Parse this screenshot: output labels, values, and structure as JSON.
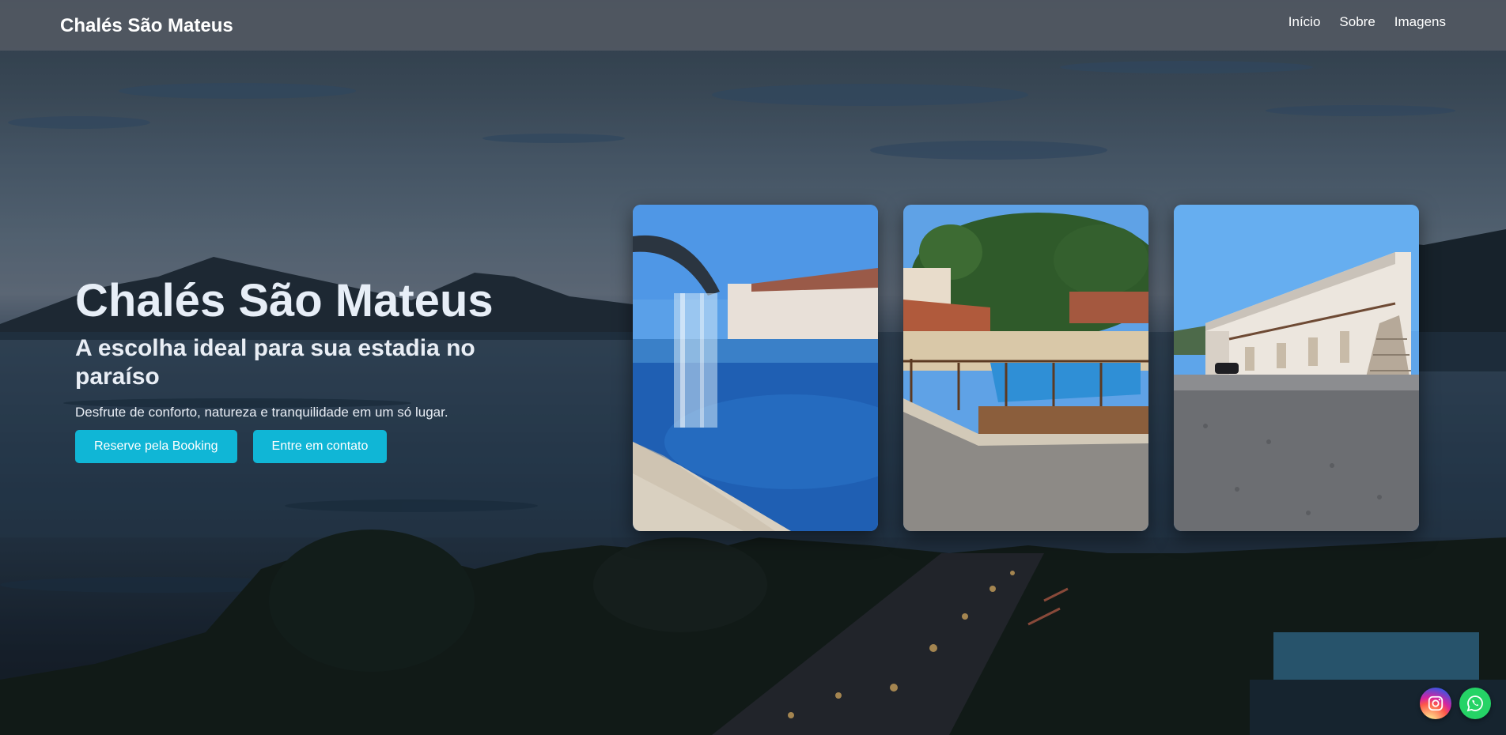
{
  "navbar": {
    "brand": "Chalés São Mateus",
    "links": [
      {
        "label": "Início"
      },
      {
        "label": "Sobre"
      },
      {
        "label": "Imagens"
      }
    ]
  },
  "hero": {
    "title": "Chalés São Mateus",
    "subtitle": "A escolha ideal para sua estadia no paraíso",
    "description": "Desfrute de conforto, natureza e tranquilidade em um só lugar.",
    "buttons": [
      {
        "label": "Reserve pela Booking"
      },
      {
        "label": "Entre em contato"
      }
    ]
  },
  "gallery": {
    "images": [
      {
        "icon": "pool-waterfall-photo"
      },
      {
        "icon": "pool-deck-palms-photo"
      },
      {
        "icon": "chalet-building-photo"
      }
    ]
  },
  "social": {
    "instagram_icon": "instagram-icon",
    "whatsapp_icon": "whatsapp-icon"
  },
  "colors": {
    "accent": "#10b6d6",
    "navbar": "#555a64",
    "whatsapp": "#25d366"
  }
}
